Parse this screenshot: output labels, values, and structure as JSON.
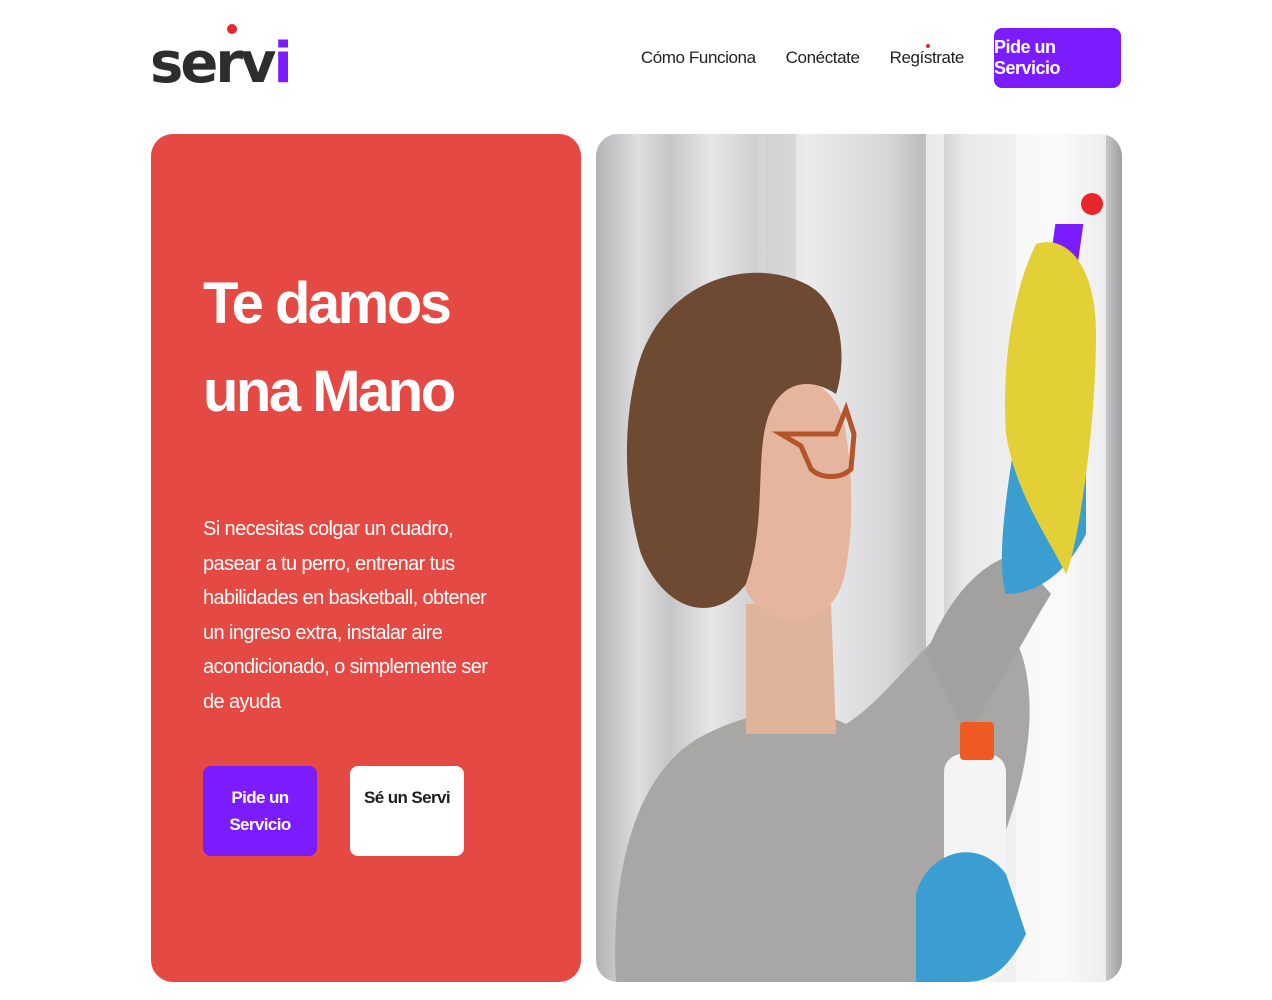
{
  "brand": {
    "name": "servi",
    "name_main": "serv",
    "name_accent": "i",
    "colors": {
      "text": "#2d2d2d",
      "accent": "#7b1cff",
      "dot": "#e8262b"
    }
  },
  "nav": {
    "links": [
      "Cómo Funciona",
      "Conéctate",
      "Regístrate"
    ],
    "cta_label": "Pide un Servicio"
  },
  "hero": {
    "title_line1": "Te damos",
    "title_line2": "una Mano",
    "description": "Si necesitas colgar un cuadro, pasear a tu perro, entrenar tus habilidades en basketball, obtener un ingreso extra, instalar aire acondicionado, o simplemente ser de ayuda",
    "primary_button": "Pide un Servicio",
    "secondary_button": "Sé un Servi",
    "background_color": "#e54943"
  },
  "photo": {
    "subject": "woman-cleaning-window-photo",
    "overlay_logo_letter": "i"
  }
}
